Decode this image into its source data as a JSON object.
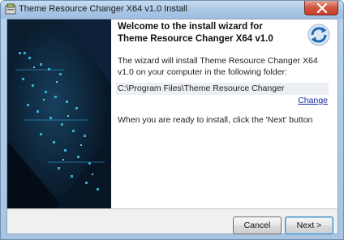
{
  "window": {
    "title": "Theme Resource Changer X64 v1.0 Install"
  },
  "content": {
    "heading": "Welcome to the install wizard for Theme Resource Changer X64 v1.0",
    "intro": "The wizard will install Theme Resource Changer X64 v1.0 on your computer in the following folder:",
    "install_path": "C:\\Program Files\\Theme Resource Changer",
    "change_link": "Change",
    "hint": "When you are ready to install, click the 'Next' button"
  },
  "buttons": {
    "cancel": "Cancel",
    "next": "Next >"
  },
  "icons": {
    "app": "installer-icon",
    "close": "close-icon",
    "logo": "refresh-logo-icon"
  },
  "colors": {
    "title_bar": "#aac6e6",
    "close_button": "#c7402a",
    "link": "#1a2aa6",
    "side_panel": "#06101e"
  }
}
